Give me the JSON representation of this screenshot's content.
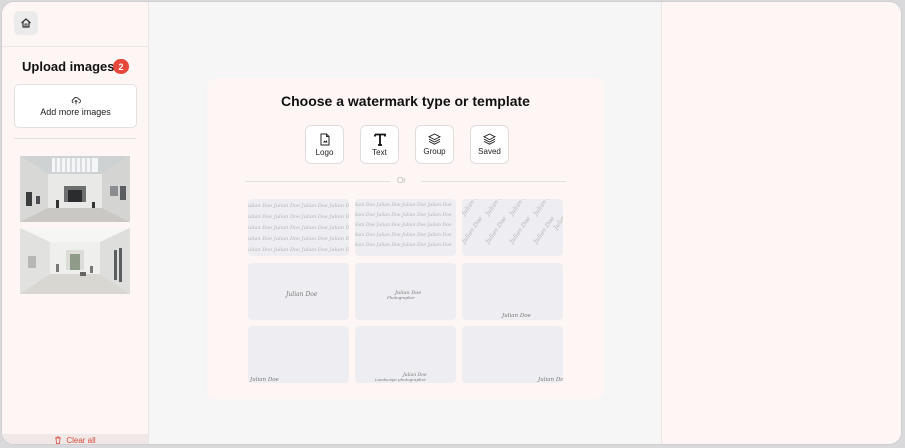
{
  "sidebar": {
    "upload_title": "Upload images",
    "upload_count": "2",
    "add_more_label": "Add more images",
    "clear_all_label": "Clear all",
    "images": [
      {
        "alt": "Gallery hall with skylight"
      },
      {
        "alt": "Gallery hall with sculptures"
      }
    ]
  },
  "main": {
    "title": "Choose a watermark type or template",
    "types": [
      {
        "label": "Logo",
        "icon": "file-image-icon"
      },
      {
        "label": "Text",
        "icon": "text-t-icon"
      },
      {
        "label": "Group",
        "icon": "layers-icon"
      },
      {
        "label": "Saved",
        "icon": "saved-layers-icon"
      }
    ],
    "or_label": "Or",
    "watermark_text": "Julian Doe"
  },
  "colors": {
    "badge": "#e8473b",
    "clear_all": "#d64a3d",
    "panel_bg": "#fdf6f5",
    "canvas_bg": "#f6f6f6",
    "template_bg": "#eeeef2"
  }
}
